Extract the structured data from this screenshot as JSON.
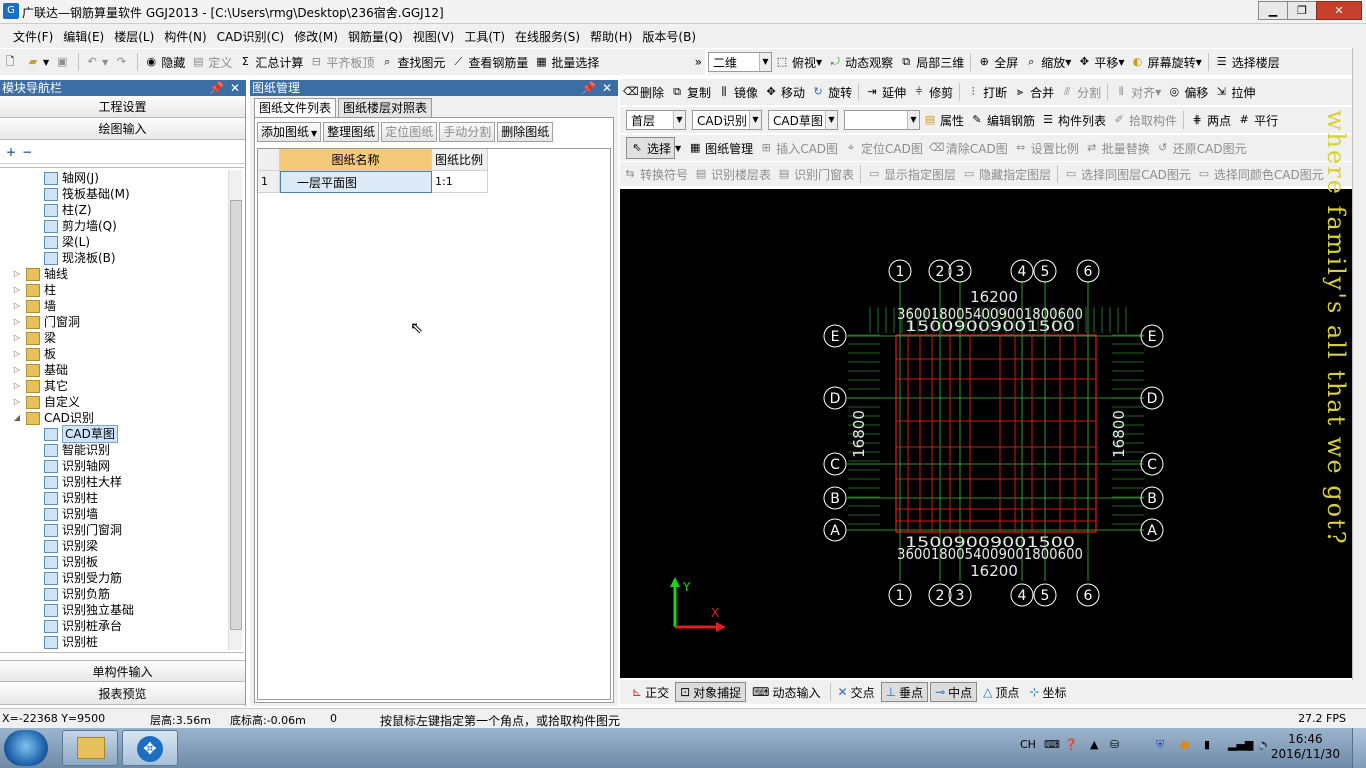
{
  "window": {
    "title": "广联达—钢筋算量软件 GGJ2013 - [C:\\Users\\rmg\\Desktop\\236宿舍.GGJ12]"
  },
  "menu": [
    "文件(F)",
    "编辑(E)",
    "楼层(L)",
    "构件(N)",
    "CAD识别(C)",
    "修改(M)",
    "钢筋量(Q)",
    "视图(V)",
    "工具(T)",
    "在线服务(S)",
    "帮助(H)",
    "版本号(B)"
  ],
  "toolbar1": {
    "hide": "隐藏",
    "define": "定义",
    "sum_calc": "汇总计算",
    "flush_top": "平齐板顶",
    "find_elem": "查找图元",
    "view_rebar": "查看钢筋量",
    "batch_select": "批量选择",
    "overflow": "»"
  },
  "toolbar_view": {
    "mode": "二维",
    "top_view": "俯视",
    "dynamic": "动态观察",
    "local_3d": "局部三维",
    "full_screen": "全屏",
    "zoom": "缩放",
    "pan": "平移",
    "screen_rotate": "屏幕旋转",
    "select_floor": "选择楼层"
  },
  "toolbar_edit": {
    "delete": "删除",
    "copy": "复制",
    "mirror": "镜像",
    "move": "移动",
    "rotate": "旋转",
    "extend": "延伸",
    "trim": "修剪",
    "break": "打断",
    "merge": "合并",
    "split": "分割",
    "align": "对齐",
    "offset": "偏移",
    "stretch": "拉伸"
  },
  "toolbar_props": {
    "floor": "首层",
    "cad_recog": "CAD识别",
    "cad_sketch": "CAD草图",
    "blank": "",
    "properties": "属性",
    "edit_rebar": "编辑钢筋",
    "comp_list": "构件列表",
    "pick_comp": "拾取构件",
    "two_points": "两点",
    "parallel": "平行"
  },
  "toolbar_cad": {
    "select": "选择",
    "drawing_mgmt": "图纸管理",
    "insert_cad": "插入CAD图",
    "locate_cad": "定位CAD图",
    "clear_cad": "清除CAD图",
    "set_scale": "设置比例",
    "batch_replace": "批量替换",
    "restore_cad": "还原CAD图元"
  },
  "toolbar_cad2": {
    "convert_sym": "转换符号",
    "recog_floor": "识别楼层表",
    "recog_door": "识别门窗表",
    "show_layer": "显示指定图层",
    "hide_layer": "隐藏指定图层",
    "same_layer": "选择同图层CAD图元",
    "same_color": "选择同颜色CAD图元"
  },
  "nav": {
    "title": "模块导航栏",
    "project_settings": "工程设置",
    "drawing_input": "绘图输入",
    "single_comp": "单构件输入",
    "report": "报表预览",
    "tree": [
      {
        "label": "轴网(J)",
        "type": "leaf",
        "indent": 1
      },
      {
        "label": "筏板基础(M)",
        "type": "leaf",
        "indent": 1
      },
      {
        "label": "柱(Z)",
        "type": "leaf",
        "indent": 1
      },
      {
        "label": "剪力墙(Q)",
        "type": "leaf",
        "indent": 1
      },
      {
        "label": "梁(L)",
        "type": "leaf",
        "indent": 1
      },
      {
        "label": "现浇板(B)",
        "type": "leaf",
        "indent": 1
      },
      {
        "label": "轴线",
        "type": "folder",
        "indent": 0
      },
      {
        "label": "柱",
        "type": "folder",
        "indent": 0
      },
      {
        "label": "墙",
        "type": "folder",
        "indent": 0
      },
      {
        "label": "门窗洞",
        "type": "folder",
        "indent": 0
      },
      {
        "label": "梁",
        "type": "folder",
        "indent": 0
      },
      {
        "label": "板",
        "type": "folder",
        "indent": 0
      },
      {
        "label": "基础",
        "type": "folder",
        "indent": 0
      },
      {
        "label": "其它",
        "type": "folder",
        "indent": 0
      },
      {
        "label": "自定义",
        "type": "folder",
        "indent": 0
      },
      {
        "label": "CAD识别",
        "type": "folder-open",
        "indent": 0
      },
      {
        "label": "CAD草图",
        "type": "leaf",
        "indent": 1,
        "selected": true
      },
      {
        "label": "智能识别",
        "type": "leaf",
        "indent": 1
      },
      {
        "label": "识别轴网",
        "type": "leaf",
        "indent": 1
      },
      {
        "label": "识别柱大样",
        "type": "leaf",
        "indent": 1
      },
      {
        "label": "识别柱",
        "type": "leaf",
        "indent": 1
      },
      {
        "label": "识别墙",
        "type": "leaf",
        "indent": 1
      },
      {
        "label": "识别门窗洞",
        "type": "leaf",
        "indent": 1
      },
      {
        "label": "识别梁",
        "type": "leaf",
        "indent": 1
      },
      {
        "label": "识别板",
        "type": "leaf",
        "indent": 1
      },
      {
        "label": "识别受力筋",
        "type": "leaf",
        "indent": 1
      },
      {
        "label": "识别负筋",
        "type": "leaf",
        "indent": 1
      },
      {
        "label": "识别独立基础",
        "type": "leaf",
        "indent": 1
      },
      {
        "label": "识别桩承台",
        "type": "leaf",
        "indent": 1
      },
      {
        "label": "识别桩",
        "type": "leaf",
        "indent": 1
      }
    ]
  },
  "drawing_mgmt": {
    "title": "图纸管理",
    "tab1": "图纸文件列表",
    "tab2": "图纸楼层对照表",
    "add": "添加图纸",
    "organize": "整理图纸",
    "locate": "定位图纸",
    "manual_split": "手动分割",
    "delete": "删除图纸",
    "col_name": "图纸名称",
    "col_scale": "图纸比例",
    "rows": [
      {
        "no": "1",
        "name": "一层平面图",
        "scale": "1:1"
      }
    ]
  },
  "cad": {
    "top_axes": [
      "1",
      "2",
      "3",
      "4",
      "5",
      "6"
    ],
    "side_axes": [
      "E",
      "D",
      "C",
      "B",
      "A"
    ],
    "total_width": "16200",
    "total_height": "16800",
    "dims_top": "3600180054009001800600",
    "dims_top2": "15009009001500",
    "overlay": "where family's all that we got?"
  },
  "bottom_tools": [
    "正交",
    "对象捕捉",
    "动态输入",
    "交点",
    "垂点",
    "中点",
    "顶点",
    "坐标"
  ],
  "status": {
    "coords": "X=-22368 Y=9500",
    "floor_h": "层高:3.56m",
    "base_h": "底标高:-0.06m",
    "zero": "0",
    "hint": "按鼠标左键指定第一个角点，或拾取构件图元",
    "fps": "27.2 FPS"
  },
  "taskbar": {
    "lang": "CH",
    "time": "16:46",
    "date": "2016/11/30"
  }
}
